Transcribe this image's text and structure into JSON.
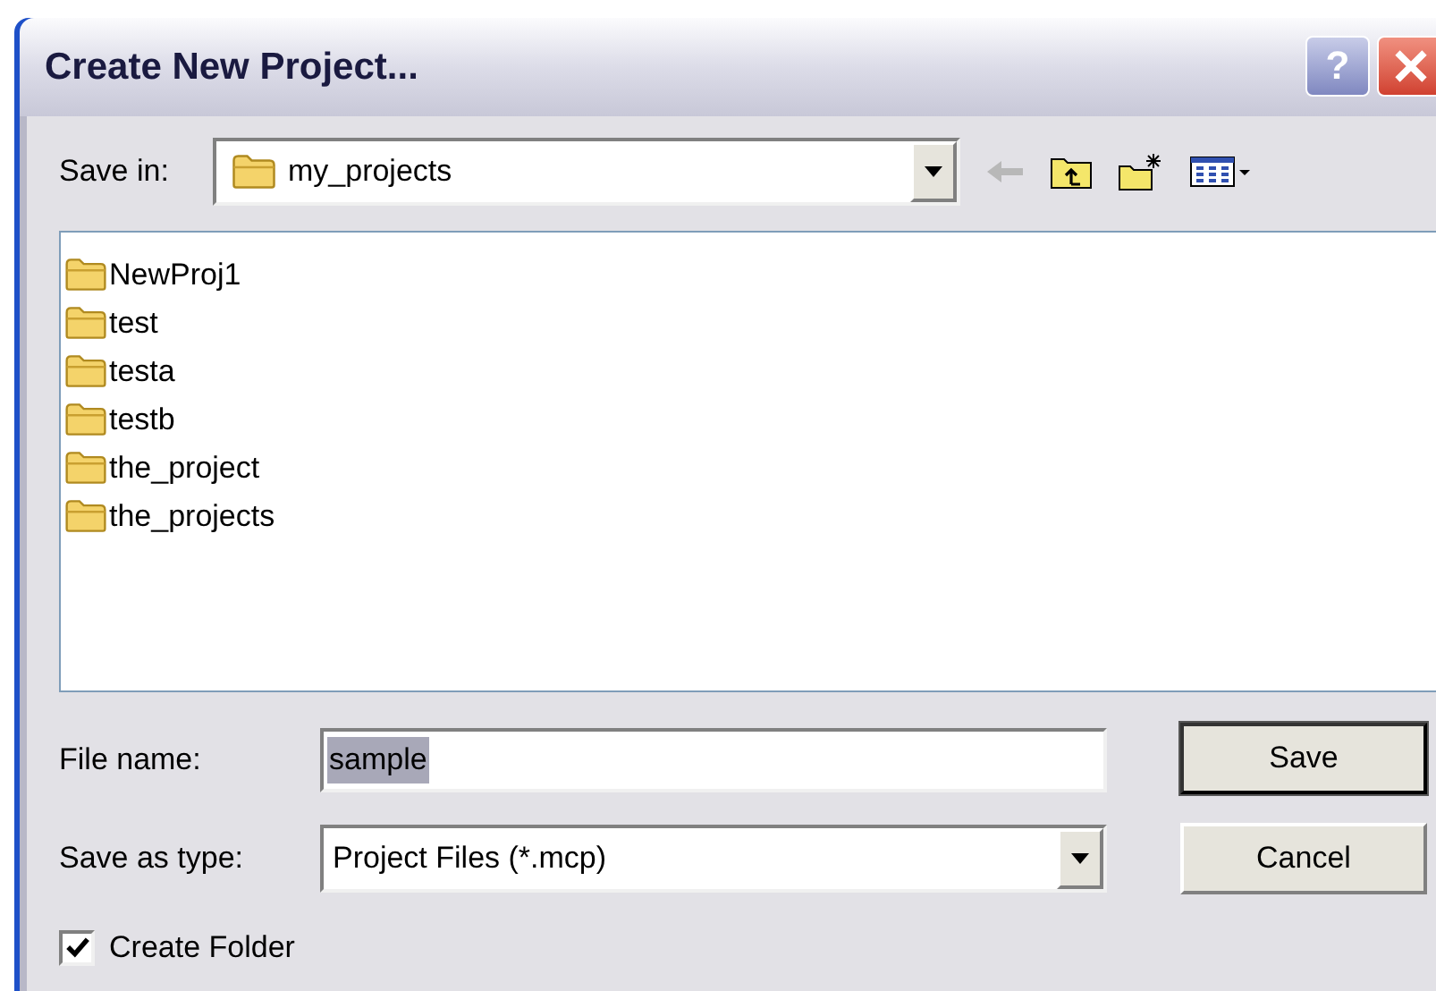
{
  "window": {
    "title": "Create New Project...",
    "buttons": [
      {
        "kind": "help",
        "label": "?"
      },
      {
        "kind": "close"
      }
    ]
  },
  "save_in": {
    "label": "Save in:",
    "value": "my_projects"
  },
  "toolbar": [
    {
      "kind": "back",
      "disabled": true
    },
    {
      "kind": "up",
      "disabled": false
    },
    {
      "kind": "new-folder",
      "disabled": false
    },
    {
      "kind": "view",
      "disabled": false
    }
  ],
  "files": [
    {
      "name": "NewProj1"
    },
    {
      "name": "test"
    },
    {
      "name": "testa"
    },
    {
      "name": "testb"
    },
    {
      "name": "the_project"
    },
    {
      "name": "the_projects"
    }
  ],
  "file_name": {
    "label": "File name:",
    "value": "sample",
    "selected": true
  },
  "save_as_type": {
    "label": "Save as type:",
    "value": "Project Files (*.mcp)"
  },
  "create_folder": {
    "label": "Create Folder",
    "checked": true
  },
  "buttons": [
    {
      "label": "Save",
      "default": true
    },
    {
      "label": "Cancel",
      "default": false
    }
  ]
}
